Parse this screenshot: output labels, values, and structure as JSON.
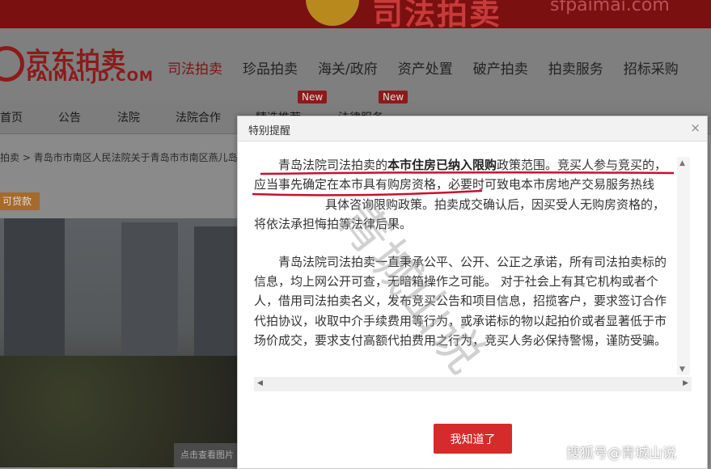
{
  "banner": {
    "headline": "司法拍卖",
    "site": "sfpaimai.com"
  },
  "brand": {
    "name": "京东拍卖",
    "domain": "PAIMAI.JD.COM",
    "accent": "#8c1a1a"
  },
  "main_nav": [
    "司法拍卖",
    "珍品拍卖",
    "海关/政府",
    "资产处置",
    "破产拍卖",
    "拍卖服务",
    "招标采购"
  ],
  "sub_nav": {
    "items": [
      "首页",
      "公告",
      "法院",
      "法院合作",
      "精选推荐",
      "法律服务"
    ],
    "badge": "New"
  },
  "breadcrumb": "拍卖 > 青岛市市南区人民法院关于青岛市市南区燕儿岛",
  "loan_badge": "可贷款",
  "photo_hint": "点击查看图片",
  "modal": {
    "title": "特别提醒",
    "close": "×",
    "para1_a": "青岛法院司法拍卖的",
    "para1_b": "本市住房已纳入限购",
    "para1_c": "政策范围。竞买人参与竞买的，应当事先确定在本市具有购房资格，必要时可致电本市房地产交易服务热线",
    "para1_d": "具体咨询限购政策。拍卖成交确认后，因买受人无购房资格的，将依法承担悔拍等法律后果。",
    "para2": "青岛法院司法拍卖一直秉承公平、公开、公正之承诺，所有司法拍卖标的信息，均上网公开可查，无暗箱操作之可能。 对于社会上有其它机构或者个人，借用司法拍卖名义，发布竞买公告和项目信息，招揽客户，要求签订合作代拍协议，收取中介手续费用等行为，或承诺标的物以起拍价或者显著低于市场价成交，要求支付高额代拍费用之行为，竞买人务必保持警惕，谨防受骗。",
    "button": "我知道了"
  },
  "watermark": "青城山说",
  "corner_watermark": "搜狐号@青城山说",
  "colors": {
    "button_red": "#d52b2b",
    "ink_red": "#c8102e"
  }
}
